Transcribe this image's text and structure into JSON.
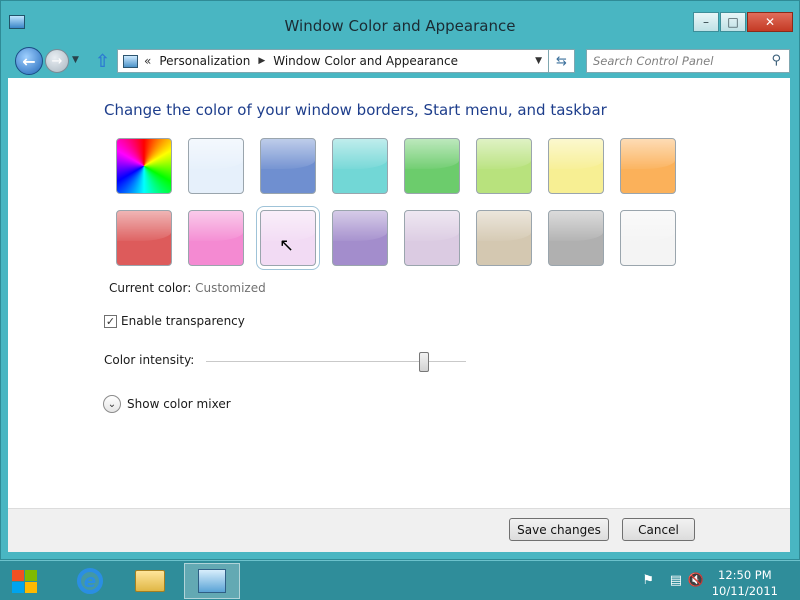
{
  "window": {
    "title": "Window Color and Appearance",
    "controls": {
      "minimize": "–",
      "maximize": "□",
      "close": "✕"
    }
  },
  "nav": {
    "back_icon": "back-arrow-icon",
    "forward_icon": "forward-arrow-icon",
    "address_chevron": "«",
    "breadcrumbs": [
      "Personalization",
      "Window Color and Appearance"
    ],
    "search_placeholder": "Search Control Panel"
  },
  "content": {
    "heading": "Change the color of your window borders, Start menu, and taskbar",
    "swatches": [
      {
        "name": "color-wheel",
        "color": "rainbow"
      },
      {
        "name": "sky",
        "color": "#e6f0fb"
      },
      {
        "name": "twilight",
        "color": "#6f8fd0"
      },
      {
        "name": "sea-foam",
        "color": "#72d7d6"
      },
      {
        "name": "leaf",
        "color": "#6ccc6c"
      },
      {
        "name": "lime",
        "color": "#b8e27d"
      },
      {
        "name": "lemon",
        "color": "#f7ef93"
      },
      {
        "name": "tangerine",
        "color": "#fbb15a"
      },
      {
        "name": "ruby",
        "color": "#dd5b5b"
      },
      {
        "name": "fuchsia",
        "color": "#f48ad2"
      },
      {
        "name": "blush",
        "color": "#f2dbf4"
      },
      {
        "name": "violet",
        "color": "#a38dcc"
      },
      {
        "name": "lavender",
        "color": "#dbcbe2"
      },
      {
        "name": "taupe",
        "color": "#d4c8b1"
      },
      {
        "name": "chocolate-gray",
        "color": "#b0b0b0"
      },
      {
        "name": "frost",
        "color": "#f4f4f4"
      }
    ],
    "selected_swatch_index": 10,
    "current_color_label": "Current color:",
    "current_color_value": "Customized",
    "enable_transparency_label": "Enable transparency",
    "enable_transparency_checked": true,
    "color_intensity_label": "Color intensity:",
    "color_intensity_value": 0.85,
    "show_color_mixer_label": "Show color mixer"
  },
  "footer": {
    "save_label": "Save changes",
    "cancel_label": "Cancel"
  },
  "taskbar": {
    "time": "12:50 PM",
    "date": "10/11/2011",
    "pinned": [
      "internet-explorer-icon",
      "file-explorer-icon",
      "control-panel-icon"
    ],
    "tray_icons": [
      "action-center-flag-icon",
      "network-icon",
      "volume-muted-icon"
    ]
  }
}
